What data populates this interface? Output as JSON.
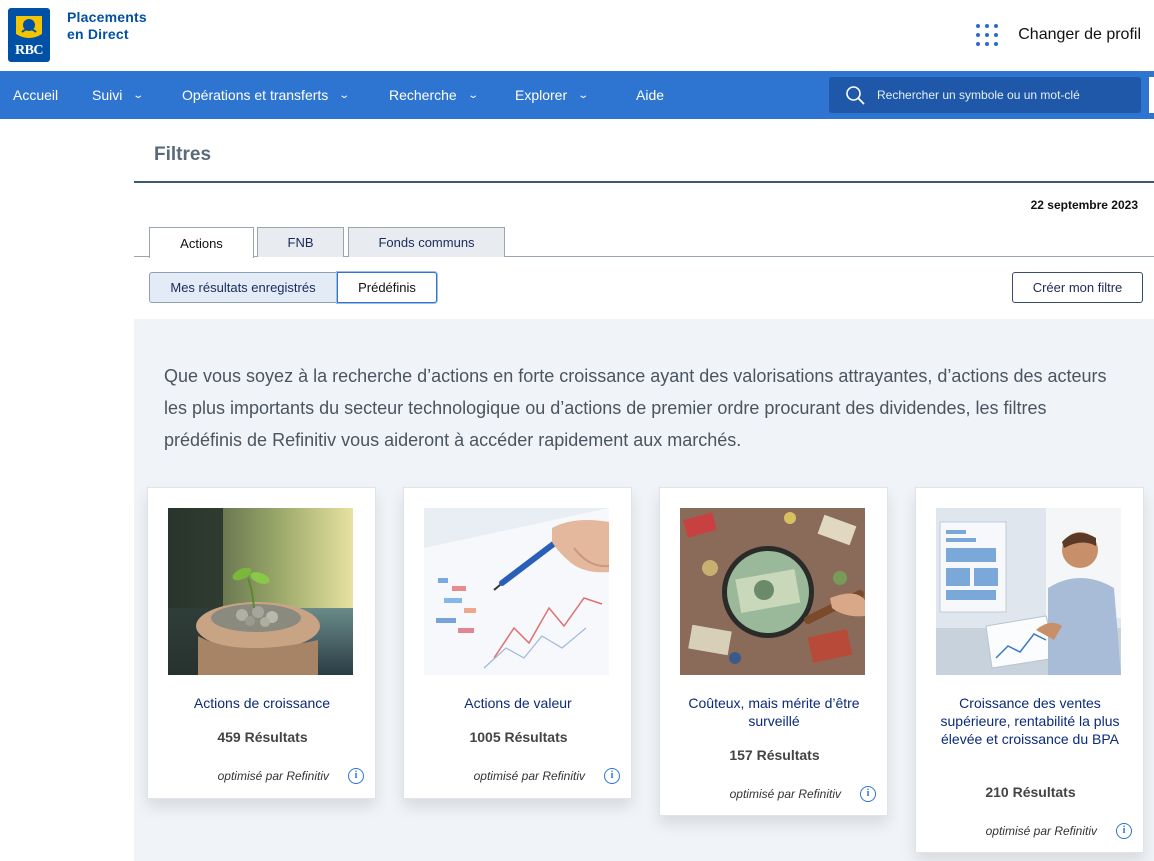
{
  "brand": {
    "line1": "Placements",
    "line2": "en Direct",
    "logo_text": "RBC"
  },
  "header": {
    "profile_label": "Changer de profil",
    "profile_icon": "apps-grid-icon"
  },
  "nav": {
    "items": [
      {
        "label": "Accueil",
        "has_menu": false
      },
      {
        "label": "Suivi",
        "has_menu": true
      },
      {
        "label": "Opérations et transferts",
        "has_menu": true
      },
      {
        "label": "Recherche",
        "has_menu": true
      },
      {
        "label": "Explorer",
        "has_menu": true
      },
      {
        "label": "Aide",
        "has_menu": false
      }
    ],
    "search_placeholder": "Rechercher un symbole ou un mot-clé"
  },
  "page": {
    "title": "Filtres",
    "date": "22 septembre 2023",
    "tabs": [
      {
        "label": "Actions",
        "active": true
      },
      {
        "label": "FNB",
        "active": false
      },
      {
        "label": "Fonds communs",
        "active": false
      }
    ],
    "segments": [
      {
        "label": "Mes résultats enregistrés",
        "active": false
      },
      {
        "label": "Prédéfinis",
        "active": true
      }
    ],
    "create_label": "Créer mon filtre",
    "intro": "Que vous soyez à la recherche d’actions en forte croissance ayant des valorisations attrayantes, d’actions des acteurs les plus importants du secteur technologique ou d’actions de premier ordre procurant des dividendes, les filtres prédéfinis de Refinitiv vous aideront à accéder rapidement aux marchés."
  },
  "cards": [
    {
      "name": "Actions de croissance",
      "results": "459 Résultats",
      "powered": "optimisé par Refinitiv"
    },
    {
      "name": "Actions de valeur",
      "results": "1005 Résultats",
      "powered": "optimisé par Refinitiv"
    },
    {
      "name": "Coûteux, mais mérite d’être surveillé",
      "results": "157 Résultats",
      "powered": "optimisé par Refinitiv"
    },
    {
      "name": "Croissance des ventes supérieure, rentabilité la plus élevée et croissance du BPA",
      "results": "210 Résultats",
      "powered": "optimisé par Refinitiv"
    }
  ],
  "colors": {
    "brand_blue": "#0051a5",
    "nav_blue": "#2e74d1",
    "panel_bg": "#f0f3f7"
  }
}
